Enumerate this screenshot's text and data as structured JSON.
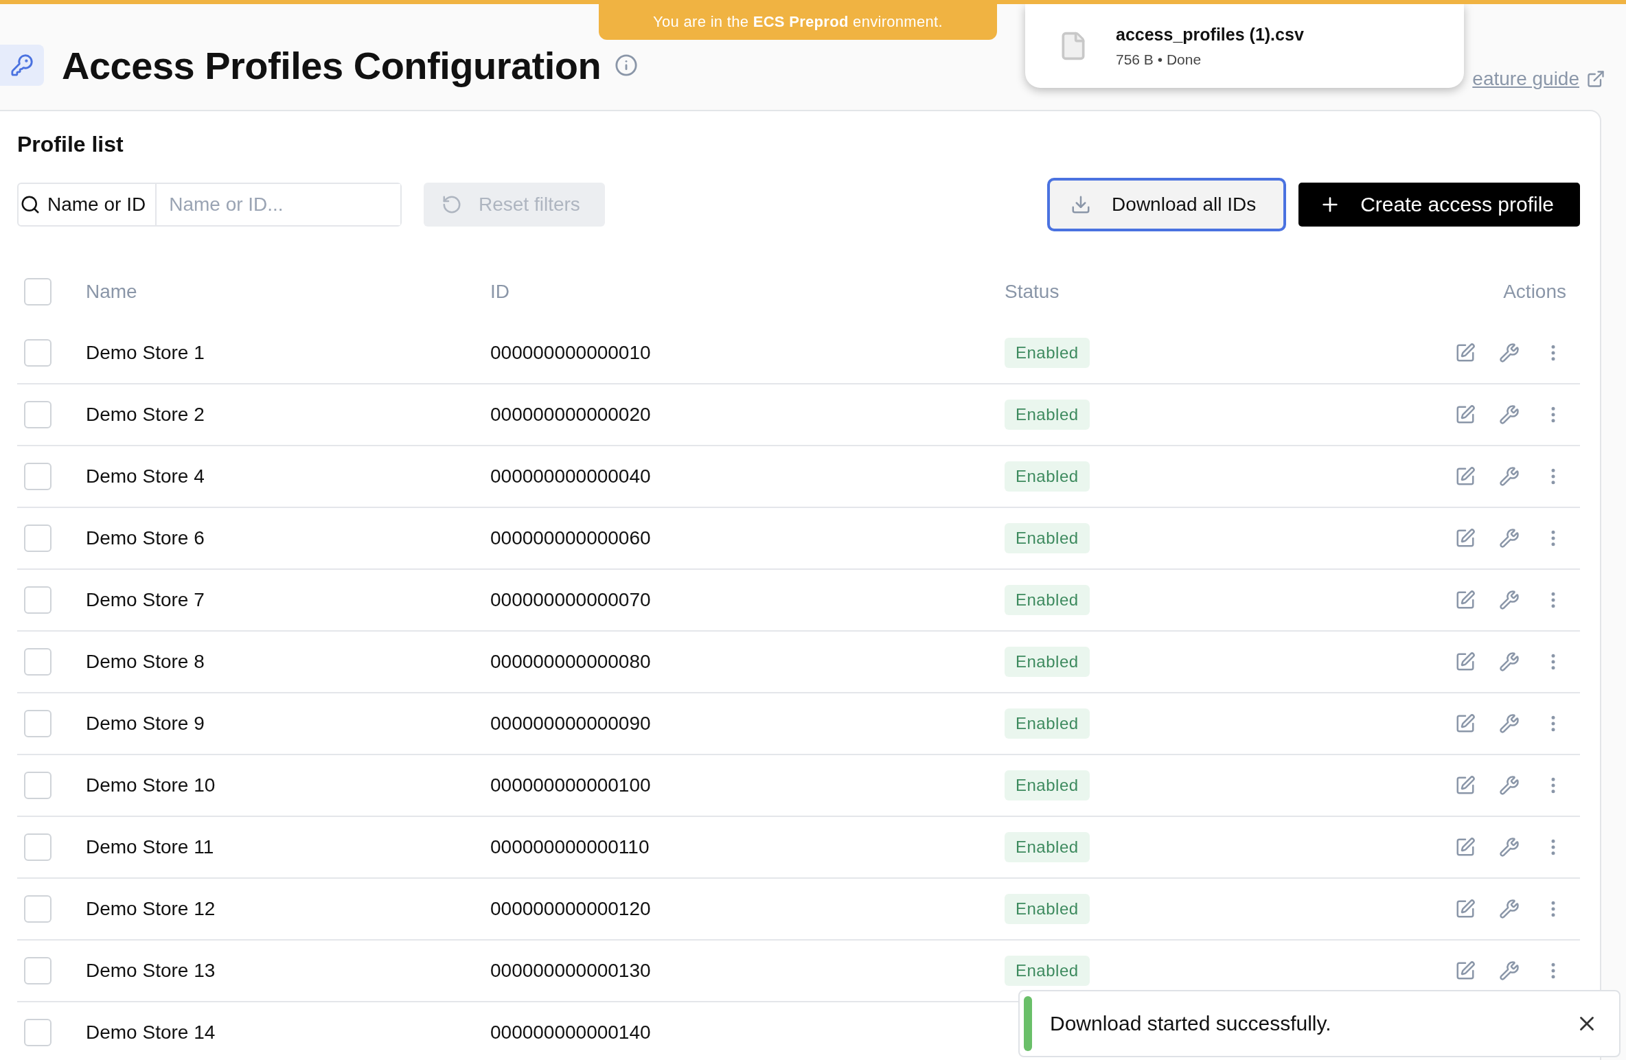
{
  "environment_banner": {
    "text": "You are in the **ECS Preprod** environment."
  },
  "header": {
    "title": "Access Profiles Configuration",
    "feature_link": "eature guide"
  },
  "download_popup": {
    "filename": "access_profiles (1).csv",
    "details": "756 B • Done"
  },
  "profile_list": {
    "heading": "Profile list",
    "search": {
      "label": "Name or ID",
      "placeholder": "Name or ID..."
    },
    "reset_button": {
      "label": "Reset filters",
      "disabled": true
    },
    "download_button": {
      "label": "Download all IDs",
      "focused": true
    },
    "create_button": {
      "label": "Create access profile"
    },
    "table": {
      "columns": [
        "Name",
        "ID",
        "Status",
        "Actions"
      ],
      "select_all_checked": false,
      "rows": [
        {
          "name": "Demo Store 1",
          "id": "000000000000010",
          "status": "Enabled",
          "checked": false
        },
        {
          "name": "Demo Store 2",
          "id": "000000000000020",
          "status": "Enabled",
          "checked": false
        },
        {
          "name": "Demo Store 4",
          "id": "000000000000040",
          "status": "Enabled",
          "checked": false
        },
        {
          "name": "Demo Store 6",
          "id": "000000000000060",
          "status": "Enabled",
          "checked": false
        },
        {
          "name": "Demo Store 7",
          "id": "000000000000070",
          "status": "Enabled",
          "checked": false
        },
        {
          "name": "Demo Store 8",
          "id": "000000000000080",
          "status": "Enabled",
          "checked": false
        },
        {
          "name": "Demo Store 9",
          "id": "000000000000090",
          "status": "Enabled",
          "checked": false
        },
        {
          "name": "Demo Store 10",
          "id": "000000000000100",
          "status": "Enabled",
          "checked": false
        },
        {
          "name": "Demo Store 11",
          "id": "000000000000110",
          "status": "Enabled",
          "checked": false
        },
        {
          "name": "Demo Store 12",
          "id": "000000000000120",
          "status": "Enabled",
          "checked": false
        },
        {
          "name": "Demo Store 13",
          "id": "000000000000130",
          "status": "Enabled",
          "checked": false
        },
        {
          "name": "Demo Store 14",
          "id": "000000000000140",
          "checked": false
        }
      ]
    }
  },
  "toast": {
    "message": "Download started successfully."
  }
}
